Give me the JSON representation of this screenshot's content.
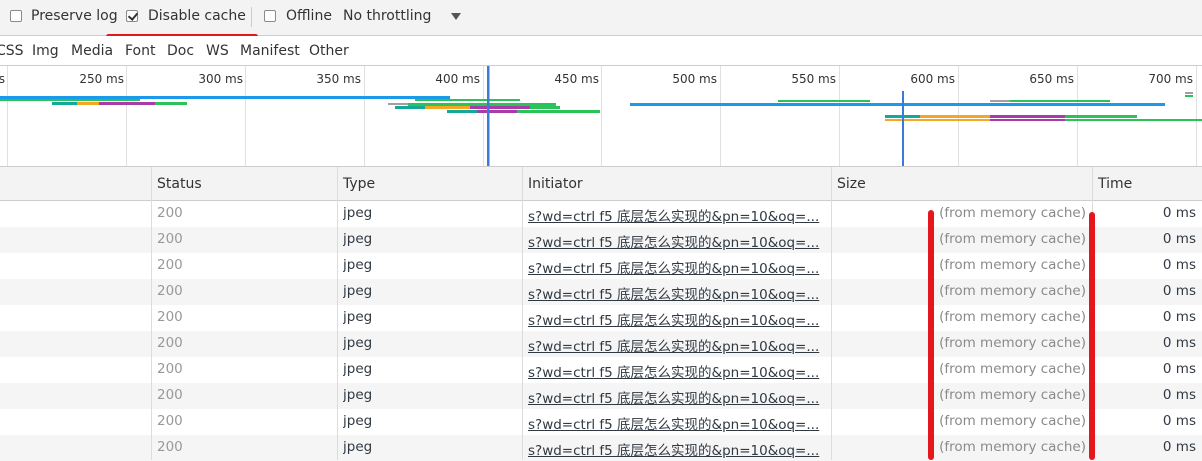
{
  "toolbar": {
    "preserve_log": {
      "label": "Preserve log",
      "checked": false
    },
    "disable_cache": {
      "label": "Disable cache",
      "checked": true
    },
    "offline": {
      "label": "Offline",
      "checked": false
    },
    "throttling": {
      "selected": "No throttling"
    }
  },
  "filters": [
    "CSS",
    "Img",
    "Media",
    "Font",
    "Doc",
    "WS",
    "Manifest",
    "Other"
  ],
  "timeline": {
    "ticks": [
      "250 ms",
      "300 ms",
      "350 ms",
      "400 ms",
      "450 ms",
      "500 ms",
      "550 ms",
      "600 ms",
      "650 ms",
      "700 ms"
    ],
    "leading_tick_fragment": "s"
  },
  "table": {
    "columns": [
      "Status",
      "Type",
      "Initiator",
      "Size",
      "Time"
    ],
    "rows": [
      {
        "status": "200",
        "type": "jpeg",
        "initiator": "s?wd=ctrl f5 底层怎么实现的&pn=10&oq=...",
        "size": "(from memory cache)",
        "time": "0 ms"
      },
      {
        "status": "200",
        "type": "jpeg",
        "initiator": "s?wd=ctrl f5 底层怎么实现的&pn=10&oq=...",
        "size": "(from memory cache)",
        "time": "0 ms"
      },
      {
        "status": "200",
        "type": "jpeg",
        "initiator": "s?wd=ctrl f5 底层怎么实现的&pn=10&oq=...",
        "size": "(from memory cache)",
        "time": "0 ms"
      },
      {
        "status": "200",
        "type": "jpeg",
        "initiator": "s?wd=ctrl f5 底层怎么实现的&pn=10&oq=...",
        "size": "(from memory cache)",
        "time": "0 ms"
      },
      {
        "status": "200",
        "type": "jpeg",
        "initiator": "s?wd=ctrl f5 底层怎么实现的&pn=10&oq=...",
        "size": "(from memory cache)",
        "time": "0 ms"
      },
      {
        "status": "200",
        "type": "jpeg",
        "initiator": "s?wd=ctrl f5 底层怎么实现的&pn=10&oq=...",
        "size": "(from memory cache)",
        "time": "0 ms"
      },
      {
        "status": "200",
        "type": "jpeg",
        "initiator": "s?wd=ctrl f5 底层怎么实现的&pn=10&oq=...",
        "size": "(from memory cache)",
        "time": "0 ms"
      },
      {
        "status": "200",
        "type": "jpeg",
        "initiator": "s?wd=ctrl f5 底层怎么实现的&pn=10&oq=...",
        "size": "(from memory cache)",
        "time": "0 ms"
      },
      {
        "status": "200",
        "type": "jpeg",
        "initiator": "s?wd=ctrl f5 底层怎么实现的&pn=10&oq=...",
        "size": "(from memory cache)",
        "time": "0 ms"
      },
      {
        "status": "200",
        "type": "jpeg",
        "initiator": "s?wd=ctrl f5 底层怎么实现的&pn=10&oq=...",
        "size": "(from memory cache)",
        "time": "0 ms"
      }
    ]
  },
  "colors": {
    "annotation": "#e6161d",
    "marker_blue": "#3a7bd5",
    "bar_blue": "#1a9ae8",
    "bar_green": "#2bc25a",
    "bar_orange": "#f5a623",
    "bar_purple": "#a83aaa",
    "bar_teal": "#12a89a",
    "bar_gray": "#a0a0a0"
  }
}
